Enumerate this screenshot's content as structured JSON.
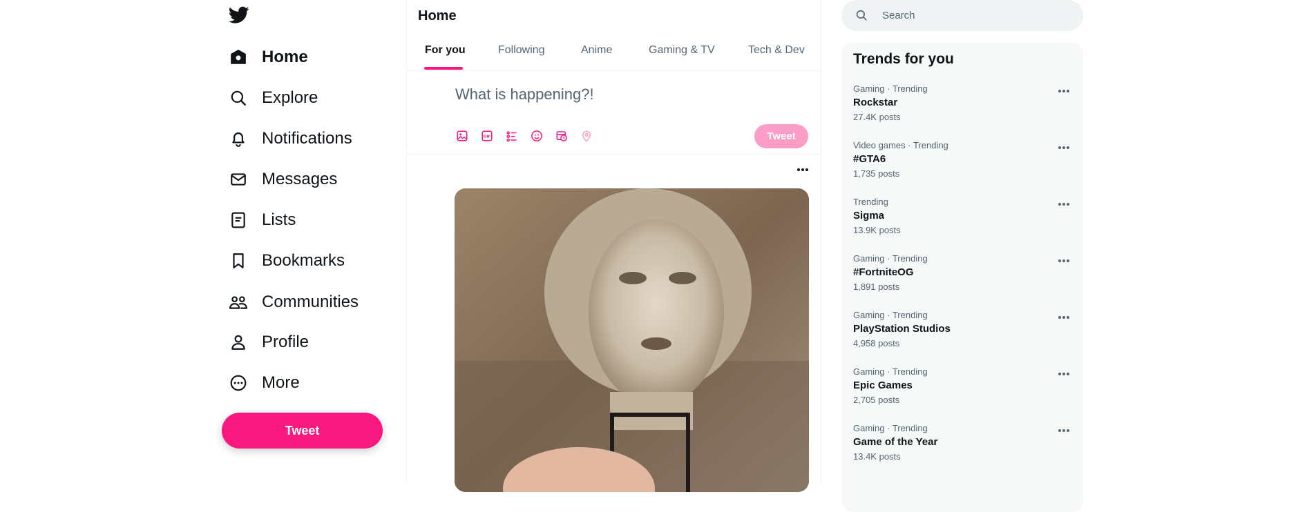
{
  "sidebar": {
    "logo_icon": "twitter-bird-icon",
    "items": [
      {
        "label": "Home",
        "icon": "home-icon",
        "active": true
      },
      {
        "label": "Explore",
        "icon": "search-icon"
      },
      {
        "label": "Notifications",
        "icon": "bell-icon"
      },
      {
        "label": "Messages",
        "icon": "envelope-icon"
      },
      {
        "label": "Lists",
        "icon": "list-icon"
      },
      {
        "label": "Bookmarks",
        "icon": "bookmark-icon"
      },
      {
        "label": "Communities",
        "icon": "people-icon"
      },
      {
        "label": "Profile",
        "icon": "person-icon"
      },
      {
        "label": "More",
        "icon": "more-circle-icon"
      }
    ],
    "tweet_button": "Tweet"
  },
  "main": {
    "title": "Home",
    "tabs": [
      {
        "label": "For you",
        "active": true
      },
      {
        "label": "Following"
      },
      {
        "label": "Anime"
      },
      {
        "label": "Gaming & TV"
      },
      {
        "label": "Tech & Dev"
      }
    ],
    "compose": {
      "placeholder": "What is happening?!",
      "icons": [
        "image-icon",
        "gif-icon",
        "poll-icon",
        "emoji-icon",
        "schedule-icon",
        "location-icon"
      ],
      "tweet_button": "Tweet"
    }
  },
  "right": {
    "search": {
      "placeholder": "Search"
    },
    "trends_title": "Trends for you",
    "trends": [
      {
        "meta": "Gaming · Trending",
        "name": "Rockstar",
        "count": "27.4K posts"
      },
      {
        "meta": "Video games · Trending",
        "name": "#GTA6",
        "count": "1,735 posts"
      },
      {
        "meta": "Trending",
        "name": "Sigma",
        "count": "13.9K posts"
      },
      {
        "meta": "Gaming · Trending",
        "name": "#FortniteOG",
        "count": "1,891 posts"
      },
      {
        "meta": "Gaming · Trending",
        "name": "PlayStation Studios",
        "count": "4,958 posts"
      },
      {
        "meta": "Gaming · Trending",
        "name": "Epic Games",
        "count": "2,705 posts"
      },
      {
        "meta": "Gaming · Trending",
        "name": "Game of the Year",
        "count": "13.4K posts"
      }
    ]
  },
  "colors": {
    "accent": "#f91880",
    "accent_disabled": "#fa9ec7",
    "text_primary": "#0f1419",
    "text_secondary": "#536471"
  }
}
